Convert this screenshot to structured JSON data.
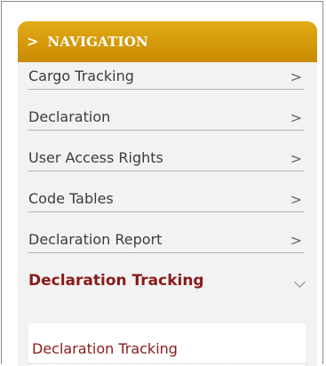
{
  "navigation": {
    "header": {
      "chevron_icon": "chevron-right-icon",
      "title": "NAVIGATION"
    },
    "items": [
      {
        "label": "Cargo Tracking",
        "arrow": ">"
      },
      {
        "label": "Declaration",
        "arrow": ">"
      },
      {
        "label": "User Access Rights",
        "arrow": ">"
      },
      {
        "label": "Code Tables",
        "arrow": ">"
      },
      {
        "label": "Declaration Report",
        "arrow": ">"
      }
    ],
    "active_item": {
      "label": "Declaration Tracking",
      "expanded_icon": "chevron-down-icon",
      "subitems": [
        {
          "label": "Declaration Tracking"
        }
      ]
    }
  },
  "colors": {
    "header_gradient_top": "#e2aa17",
    "header_gradient_bottom": "#c98b00",
    "active_text": "#8b1a1a",
    "panel_bg": "#f2f2f2"
  }
}
